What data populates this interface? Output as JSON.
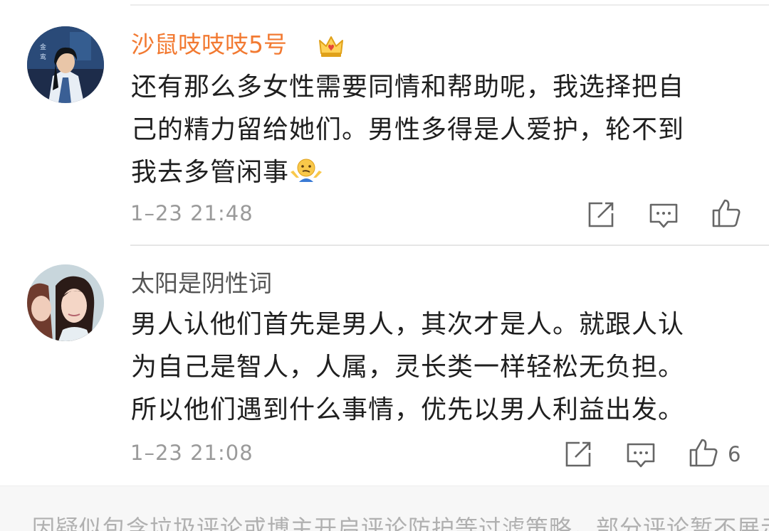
{
  "comments": [
    {
      "username": "沙鼠吱吱吱5号",
      "badge_icon": "vip-crown-icon",
      "lines": [
        "还有那么多女性需要同情和帮助呢，我选择把自",
        "己的精力留给她们。男性多得是人爱护，轮不到",
        "我去多管闲事"
      ],
      "emoji_icon": "shrug-emoji",
      "timestamp": "1–23 21:48",
      "like_count": ""
    },
    {
      "username": "太阳是阴性词",
      "lines": [
        "男人认他们首先是男人，其次才是人。就跟人认",
        "为自己是智人，人属，灵长类一样轻松无负担。",
        "所以他们遇到什么事情，优先以男人利益出发。"
      ],
      "timestamp": "1–23 21:08",
      "like_count": "6"
    }
  ],
  "actions": {
    "repost_icon": "repost-icon",
    "comment_icon": "comment-icon",
    "like_icon": "thumbs-up-icon"
  },
  "footer": {
    "note": "因疑似包含垃圾评论或博主开启评论防护等过滤策略，部分评论暂不展示"
  },
  "colors": {
    "vip_name": "#f27a32",
    "name": "#555555",
    "text": "#1f1f1f",
    "meta": "#9a9a9a"
  }
}
